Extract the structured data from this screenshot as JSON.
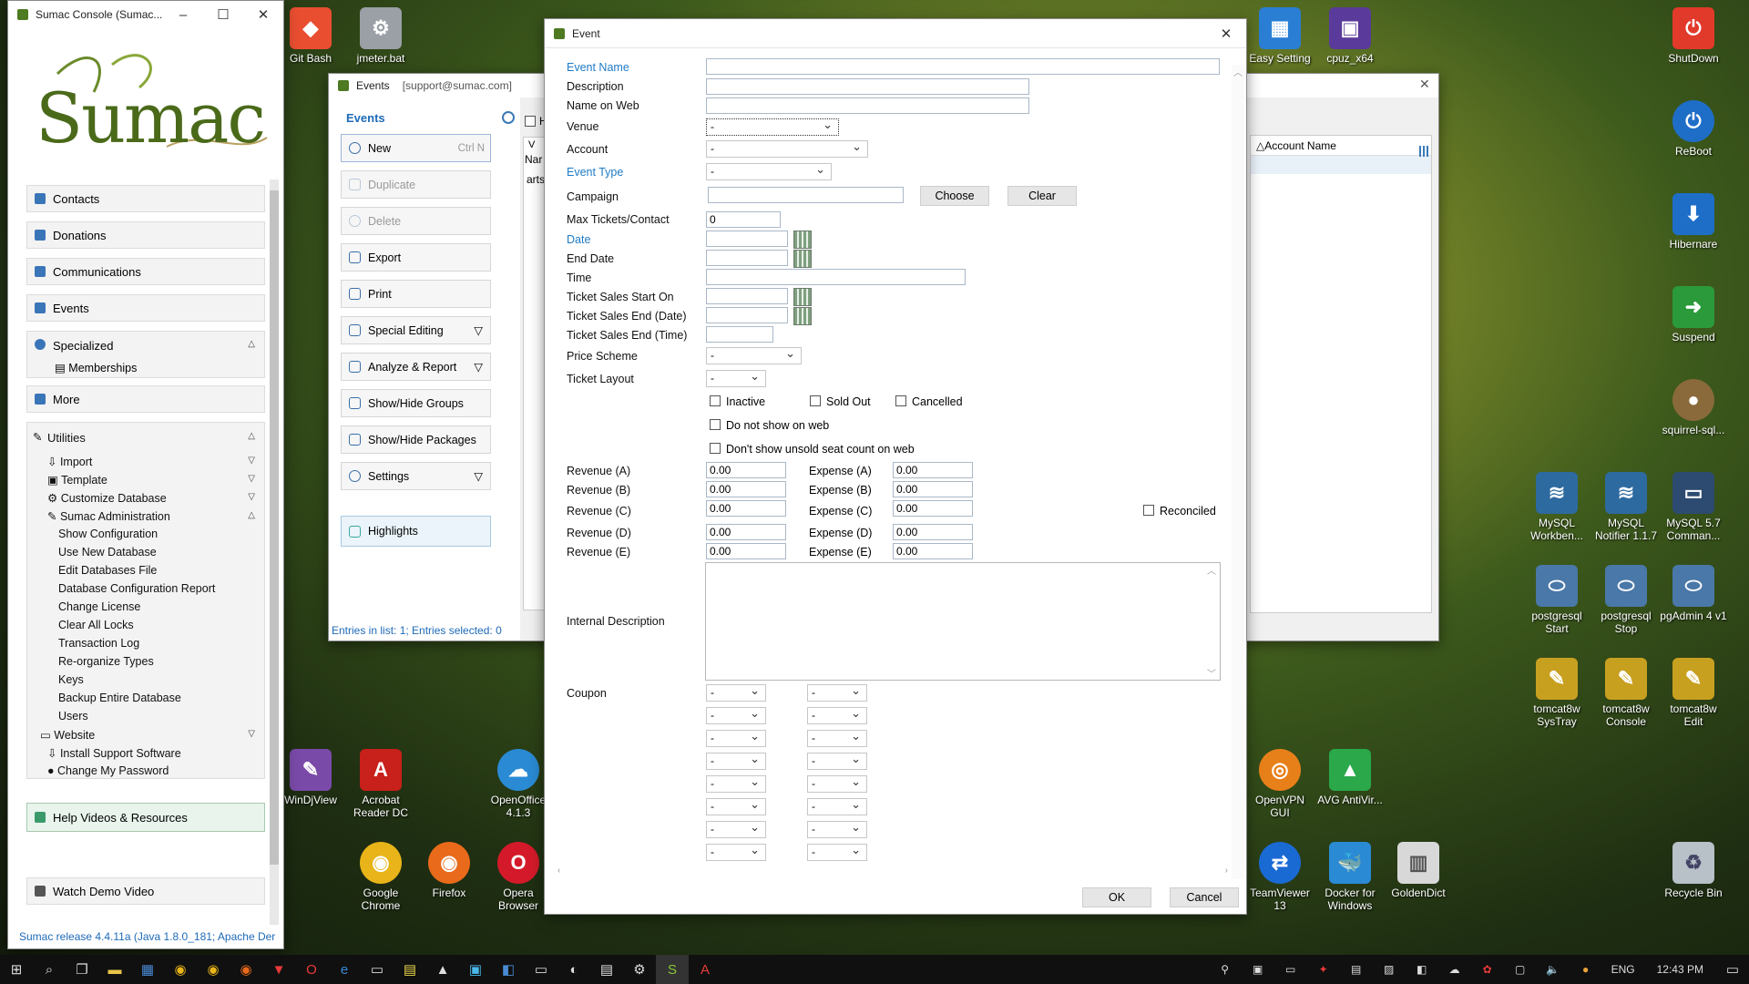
{
  "desktop": {
    "icons_top": [
      {
        "label": "Git Bash",
        "color": "#e94e31"
      },
      {
        "label": "jmeter.bat",
        "color": "#9aa0a6"
      }
    ],
    "icons_right_top": [
      {
        "label": "Easy Setting",
        "color": "#2a7fd4"
      },
      {
        "label": "cpuz_x64",
        "color": "#5a3a9a"
      }
    ],
    "icons_right": [
      {
        "label": "ShutDown",
        "color": "#e23a2a"
      },
      {
        "label": "ReBoot",
        "color": "#1e6ec8"
      },
      {
        "label": "Hibernare",
        "color": "#1e6ec8"
      },
      {
        "label": "Suspend",
        "color": "#2a9a3a"
      },
      {
        "label": "squirrel-sql...",
        "color": "#8a6a3a"
      }
    ],
    "icons_mysql": [
      {
        "label": "MySQL Workben...",
        "color": "#2d6aa0"
      },
      {
        "label": "MySQL Notifier 1.1.7",
        "color": "#2d6aa0"
      },
      {
        "label": "MySQL 5.7 Comman...",
        "color": "#2d4a70"
      }
    ],
    "icons_pg": [
      {
        "label": "postgresql Start",
        "color": "#4a78a8"
      },
      {
        "label": "postgresql Stop",
        "color": "#4a78a8"
      },
      {
        "label": "pgAdmin 4 v1",
        "color": "#4a78a8"
      }
    ],
    "icons_tomcat": [
      {
        "label": "tomcat8w SysTray",
        "color": "#c8a020"
      },
      {
        "label": "tomcat8w Console",
        "color": "#c8a020"
      },
      {
        "label": "tomcat8w Edit",
        "color": "#c8a020"
      }
    ],
    "icons_bottom1": [
      {
        "label": "WinDjView",
        "color": "#7a4aa8"
      },
      {
        "label": "Acrobat Reader DC",
        "color": "#c8201a"
      },
      {
        "label": "OpenOffice 4.1.3",
        "color": "#2a8ad4"
      }
    ],
    "icons_bottom2": [
      {
        "label": "Google Chrome",
        "color": "#e8b41a"
      },
      {
        "label": "Firefox",
        "color": "#e86a1a"
      },
      {
        "label": "Opera Browser",
        "color": "#d41a2a"
      }
    ],
    "icons_bottom_right1": [
      {
        "label": "OpenVPN GUI",
        "color": "#e8801a"
      },
      {
        "label": "AVG AntiVir...",
        "color": "#2aa84a"
      }
    ],
    "icons_bottom_right2": [
      {
        "label": "TeamViewer 13",
        "color": "#1a6ad4"
      },
      {
        "label": "Docker for Windows",
        "color": "#2a8ad4"
      },
      {
        "label": "GoldenDict",
        "color": "#d8d8d8"
      }
    ],
    "recycle": "Recycle Bin"
  },
  "console": {
    "title": "Sumac Console (Sumac...",
    "logo": "Sumac",
    "nav": [
      "Contacts",
      "Donations",
      "Communications",
      "Events"
    ],
    "specialized": "Specialized",
    "memberships": "Memberships",
    "more": "More",
    "utilities": "Utilities",
    "util_items": [
      "Import",
      "Template",
      "Customize Database",
      "Sumac Administration"
    ],
    "admin_items": [
      "Show Configuration",
      "Use New Database",
      "Edit Databases File",
      "Database Configuration Report",
      "Change License",
      "Clear All Locks",
      "Transaction Log",
      "Re-organize Types",
      "Keys",
      "Backup Entire Database",
      "Users"
    ],
    "website": "Website",
    "install": "Install Support Software",
    "change_pw": "Change My Password",
    "help": "Help Videos & Resources",
    "demo": "Watch Demo Video",
    "status": "Sumac release 4.4.11a (Java 1.8.0_181; Apache Der"
  },
  "events_win": {
    "title": "Events",
    "user": "[support@sumac.com]",
    "heading": "Events",
    "buttons": [
      {
        "label": "New",
        "shortcut": "Ctrl N",
        "enabled": true
      },
      {
        "label": "Duplicate",
        "enabled": false
      },
      {
        "label": "Delete",
        "enabled": false
      },
      {
        "label": "Export",
        "enabled": true
      },
      {
        "label": "Print",
        "enabled": true
      },
      {
        "label": "Special Editing",
        "enabled": true,
        "menu": true
      },
      {
        "label": "Analyze & Report",
        "enabled": true,
        "menu": true
      },
      {
        "label": "Show/Hide Groups",
        "enabled": true
      },
      {
        "label": "Show/Hide Packages",
        "enabled": true
      },
      {
        "label": "Settings",
        "enabled": true,
        "menu": true
      }
    ],
    "highlights": "Highlights",
    "col_frag1": "H",
    "col_frag2": "V",
    "col_frag3": "Nar",
    "row_frag": "arts",
    "status": "Entries in list: 1; Entries selected: 0",
    "account_col": "Account Name"
  },
  "dialog": {
    "title": "Event",
    "labels": {
      "event_name": "Event Name",
      "description": "Description",
      "name_on_web": "Name on Web",
      "venue": "Venue",
      "account": "Account",
      "event_type": "Event Type",
      "campaign": "Campaign",
      "max_tickets": "Max Tickets/Contact",
      "date": "Date",
      "end_date": "End Date",
      "time": "Time",
      "sales_start": "Ticket Sales Start On",
      "sales_end_date": "Ticket Sales End (Date)",
      "sales_end_time": "Ticket Sales End (Time)",
      "price_scheme": "Price Scheme",
      "ticket_layout": "Ticket Layout",
      "internal_description": "Internal Description",
      "coupon": "Coupon"
    },
    "values": {
      "venue": "-",
      "account": "-",
      "event_type": "-",
      "max_tickets": "0",
      "price_scheme": "-",
      "ticket_layout": "-"
    },
    "choose": "Choose",
    "clear": "Clear",
    "checks": {
      "inactive": "Inactive",
      "sold_out": "Sold Out",
      "cancelled": "Cancelled",
      "not_on_web": "Do not show on web",
      "unsold_count": "Don't show unsold seat count on web",
      "reconciled": "Reconciled"
    },
    "revenue": [
      {
        "label": "Revenue (A)",
        "value": "0.00",
        "exp_label": "Expense (A)",
        "exp_value": "0.00"
      },
      {
        "label": "Revenue (B)",
        "value": "0.00",
        "exp_label": "Expense (B)",
        "exp_value": "0.00"
      },
      {
        "label": "Revenue (C)",
        "value": "0.00",
        "exp_label": "Expense (C)",
        "exp_value": "0.00"
      },
      {
        "label": "Revenue (D)",
        "value": "0.00",
        "exp_label": "Expense (D)",
        "exp_value": "0.00"
      },
      {
        "label": "Revenue (E)",
        "value": "0.00",
        "exp_label": "Expense (E)",
        "exp_value": "0.00"
      }
    ],
    "coupon_value": "-",
    "ok": "OK",
    "cancel": "Cancel"
  },
  "taskbar": {
    "lang": "ENG",
    "time": "12:43 PM"
  }
}
